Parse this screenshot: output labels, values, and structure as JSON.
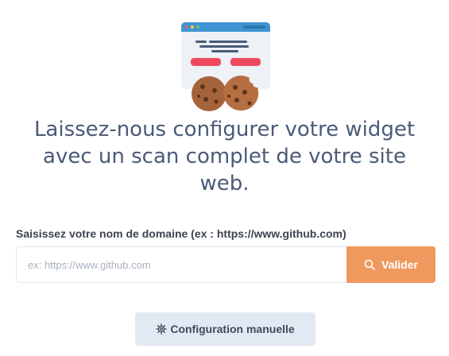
{
  "headline": "Laissez-nous configurer votre widget avec un scan complet de votre site web.",
  "domain": {
    "label": "Saisissez votre nom de domaine (ex : https://www.github.com)",
    "placeholder": "ex: https://www.github.com",
    "value": ""
  },
  "validate_button": {
    "label": "Valider",
    "icon": "search-icon"
  },
  "manual_button": {
    "label": "Configuration manuelle",
    "icon": "gear-icon"
  },
  "illustration": {
    "icon": "browser-cookies-illustration"
  },
  "colors": {
    "accent": "#f0995e",
    "headline": "#4a5a78",
    "secondary_button_bg": "#e3e9f2",
    "browser_bar": "#3e95d1",
    "cookie": "#a5633c"
  }
}
